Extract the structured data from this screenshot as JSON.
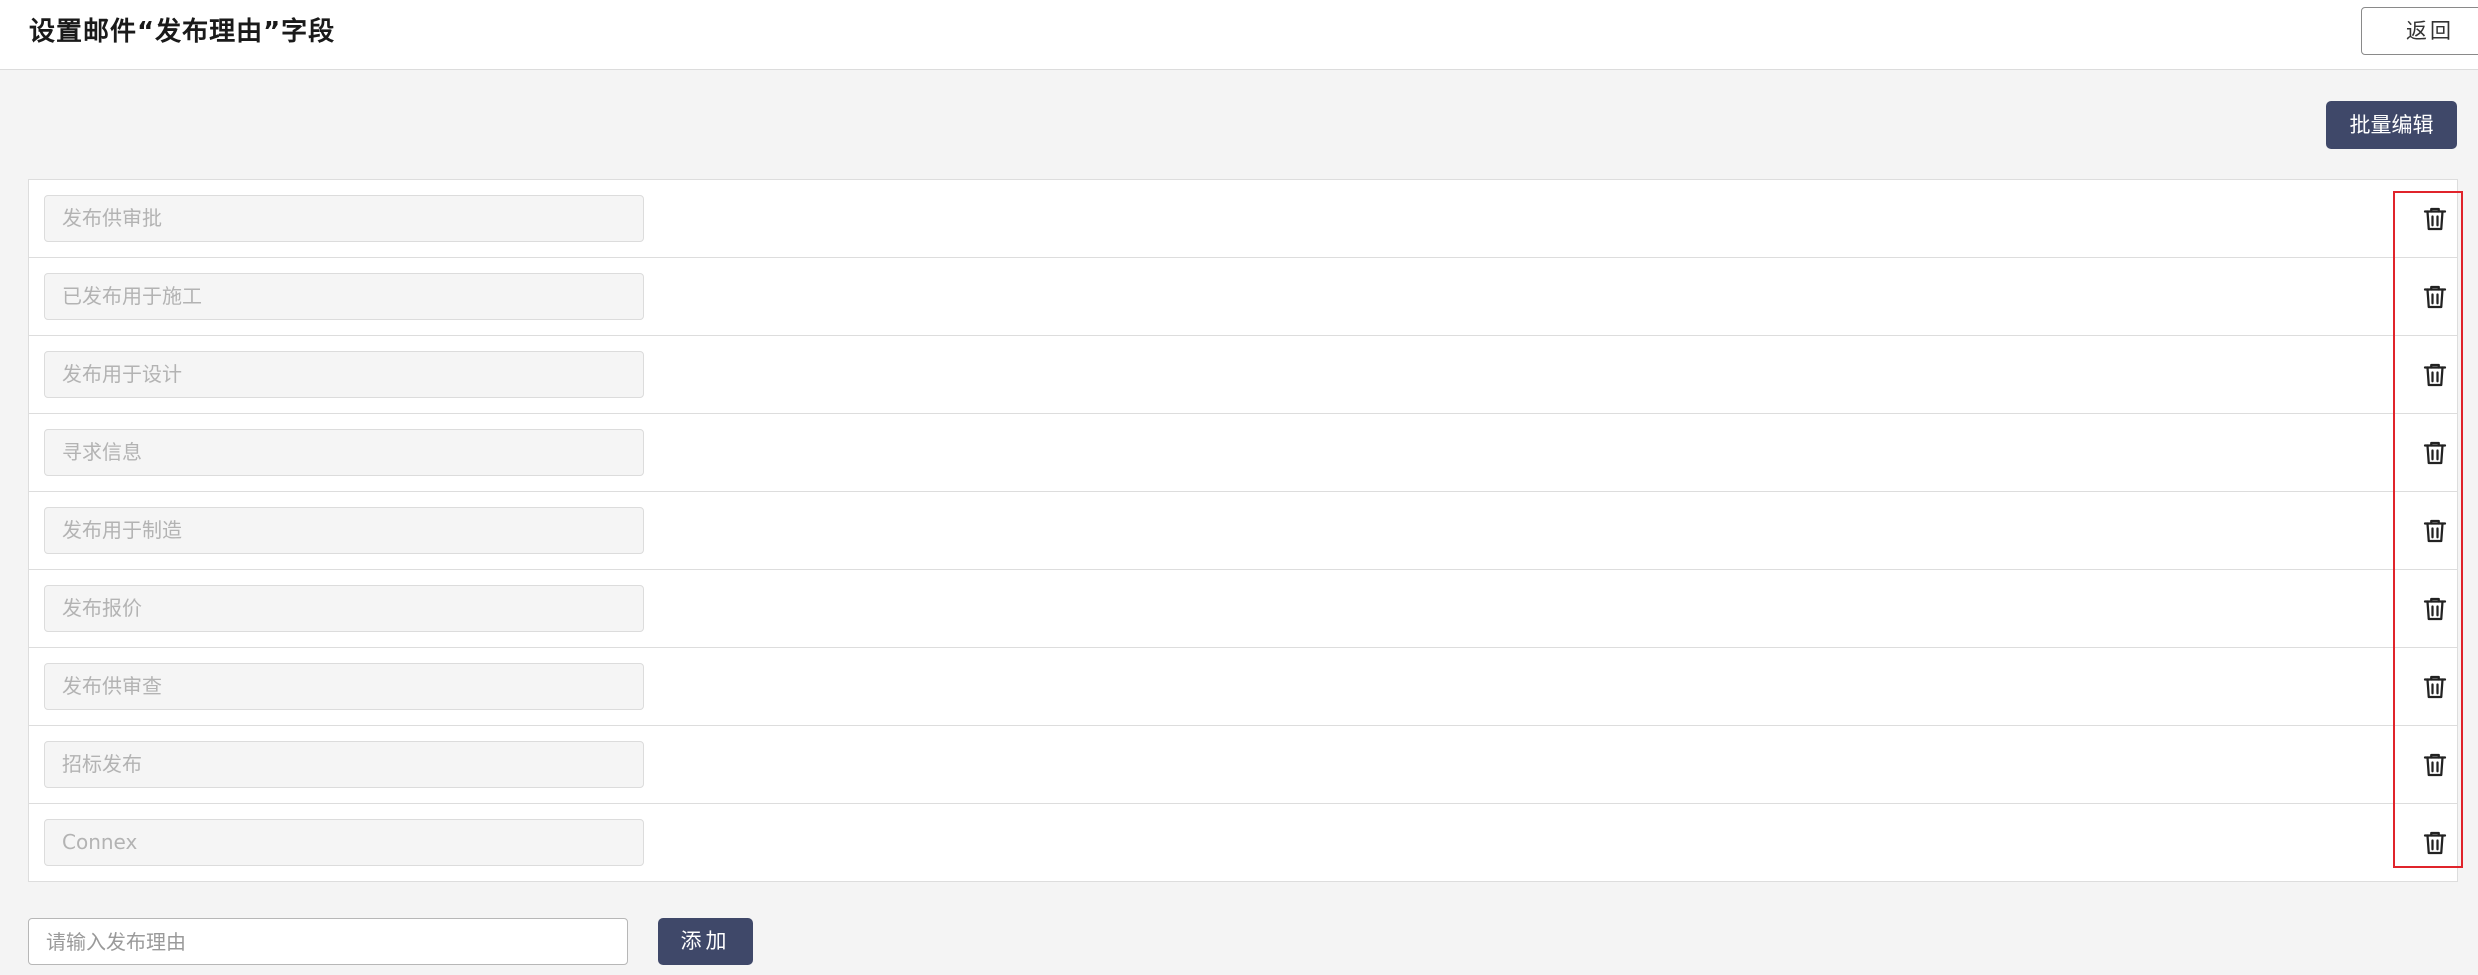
{
  "header": {
    "title": "设置邮件“发布理由”字段",
    "back_label": "返回"
  },
  "toolbar": {
    "batch_edit_label": "批量编辑"
  },
  "reasons": [
    {
      "label": "发布供审批"
    },
    {
      "label": "已发布用于施工"
    },
    {
      "label": "发布用于设计"
    },
    {
      "label": "寻求信息"
    },
    {
      "label": "发布用于制造"
    },
    {
      "label": "发布报价"
    },
    {
      "label": "发布供审查"
    },
    {
      "label": "招标发布"
    },
    {
      "label": "Connex"
    }
  ],
  "row_icon": "trash-icon",
  "add": {
    "placeholder": "请输入发布理由",
    "button_label": "添加"
  },
  "colors": {
    "primary_button": "#3f4869",
    "highlight_box": "#e0242b",
    "background": "#f4f4f4"
  }
}
